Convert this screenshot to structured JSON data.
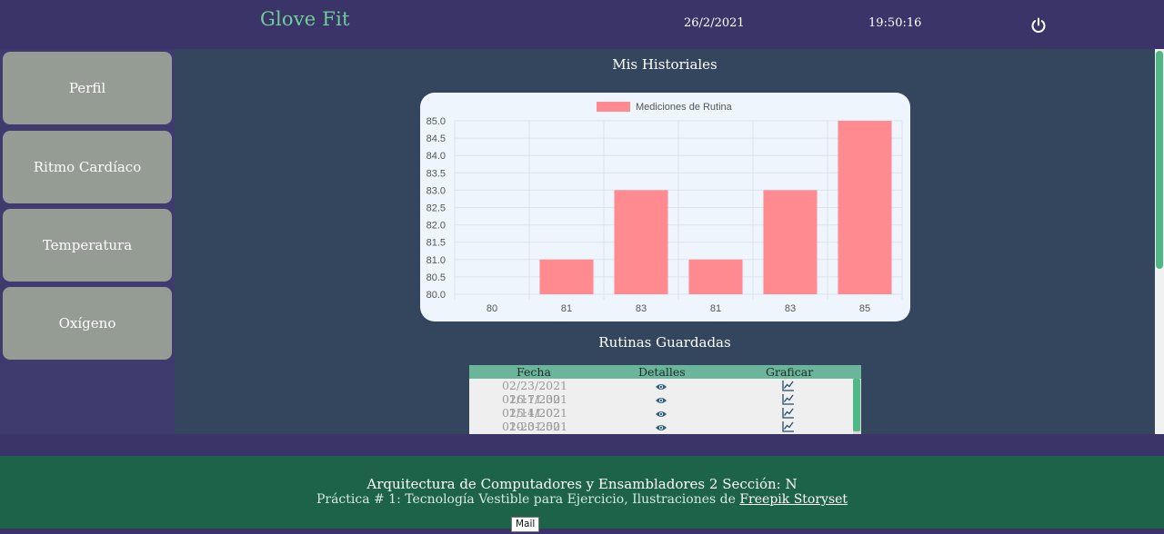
{
  "header": {
    "brand": "Glove Fit",
    "date": "26/2/2021",
    "time": "19:50:16",
    "power_icon": "power-icon",
    "brand_color": "#6fcf9a"
  },
  "sidebar": {
    "items": [
      {
        "label": "Perfil"
      },
      {
        "label": "Ritmo Cardíaco"
      },
      {
        "label": "Temperatura"
      },
      {
        "label": "Oxígeno"
      }
    ]
  },
  "main": {
    "history_title": "Mis Historiales",
    "routines_title": "Rutinas Guardadas"
  },
  "chart_data": {
    "type": "bar",
    "categories": [
      "80",
      "81",
      "83",
      "81",
      "83",
      "85"
    ],
    "series": [
      {
        "name": "Mediciones de Rutina",
        "values": [
          80,
          81,
          83,
          81,
          83,
          85
        ],
        "color": "#ff8a8f"
      }
    ],
    "ylim": [
      80.0,
      85.0
    ],
    "yticks": [
      "85.0",
      "84.5",
      "84.0",
      "83.5",
      "83.0",
      "82.5",
      "82.0",
      "81.5",
      "81.0",
      "80.5",
      "80.0"
    ],
    "grid": true,
    "legend_position": "top-center"
  },
  "routines_table": {
    "headers": [
      "Fecha",
      "Detalles",
      "Graficar"
    ],
    "rows": [
      {
        "fecha": "02/23/2021 16:11:30",
        "detalles_icon": "eye-icon",
        "graficar_icon": "chart-line-icon"
      },
      {
        "fecha": "02/17/2021 15:41:02",
        "detalles_icon": "eye-icon",
        "graficar_icon": "chart-line-icon"
      },
      {
        "fecha": "02/11/2021 10:01:50",
        "detalles_icon": "eye-icon",
        "graficar_icon": "chart-line-icon"
      },
      {
        "fecha": "02-23-2021 04:44:45",
        "detalles_icon": "eye-icon",
        "graficar_icon": "chart-line-icon"
      }
    ]
  },
  "footer": {
    "title": "Arquitectura de Computadores y Ensambladores 2 Sección: N",
    "subtitle_prefix": "Práctica # 1: Tecnología Vestible para Ejercicio, Ilustraciones de ",
    "link_text": "Freepik Storyset",
    "tooltip": "Mail"
  }
}
